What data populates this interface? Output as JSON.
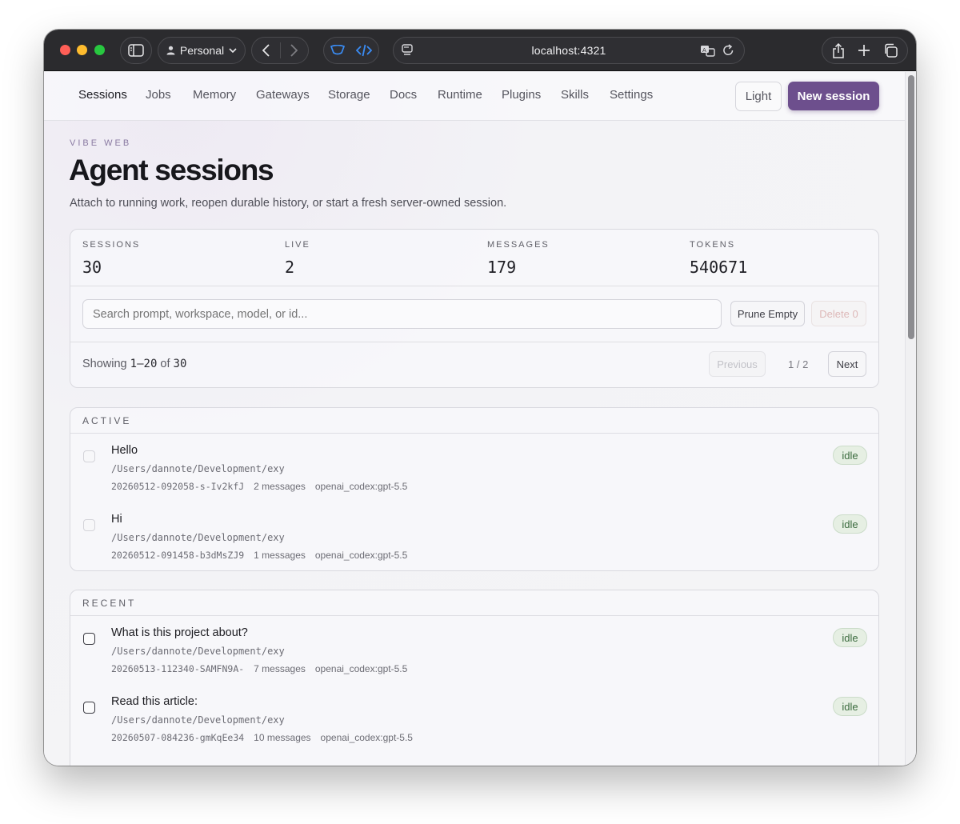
{
  "browser": {
    "profile": "Personal",
    "url": "localhost:4321"
  },
  "nav": {
    "items": [
      "Sessions",
      "Jobs",
      "Memory",
      "Gateways",
      "Storage",
      "Docs",
      "Runtime",
      "Plugins",
      "Skills",
      "Settings"
    ],
    "active": "Sessions",
    "theme_label": "Light",
    "new_session_label": "New session"
  },
  "header": {
    "eyebrow": "VIBE WEB",
    "title": "Agent sessions",
    "subtitle": "Attach to running work, reopen durable history, or start a fresh server-owned session."
  },
  "stats": [
    {
      "label": "SESSIONS",
      "value": "30"
    },
    {
      "label": "LIVE",
      "value": "2"
    },
    {
      "label": "MESSAGES",
      "value": "179"
    },
    {
      "label": "TOKENS",
      "value": "540671"
    }
  ],
  "search": {
    "placeholder": "Search prompt, workspace, model, or id...",
    "value": ""
  },
  "actions": {
    "prune_label": "Prune Empty",
    "delete_label": "Delete 0"
  },
  "pagination": {
    "showing_prefix": "Showing",
    "range": "1–20",
    "of_word": "of",
    "total": "30",
    "previous_label": "Previous",
    "page_indicator": "1 / 2",
    "next_label": "Next"
  },
  "sections": {
    "active": {
      "title": "ACTIVE",
      "rows": [
        {
          "title": "Hello",
          "path": "/Users/dannote/Development/exy",
          "id": "20260512-092058-s-Iv2kfJ",
          "messages": "2 messages",
          "model": "openai_codex:gpt-5.5",
          "status": "idle"
        },
        {
          "title": "Hi",
          "path": "/Users/dannote/Development/exy",
          "id": "20260512-091458-b3dMsZJ9",
          "messages": "1 messages",
          "model": "openai_codex:gpt-5.5",
          "status": "idle"
        }
      ]
    },
    "recent": {
      "title": "RECENT",
      "rows": [
        {
          "title": "What is this project about?",
          "path": "/Users/dannote/Development/exy",
          "id": "20260513-112340-SAMFN9A-",
          "messages": "7 messages",
          "model": "openai_codex:gpt-5.5",
          "status": "idle"
        },
        {
          "title": "Read this article:",
          "path": "/Users/dannote/Development/exy",
          "id": "20260507-084236-gmKqEe34",
          "messages": "10 messages",
          "model": "openai_codex:gpt-5.5",
          "status": "idle"
        }
      ]
    }
  },
  "colors": {
    "accent": "#6d4f8d",
    "idle_badge_bg": "#e6efe3",
    "idle_badge_text": "#3b6b3e"
  }
}
